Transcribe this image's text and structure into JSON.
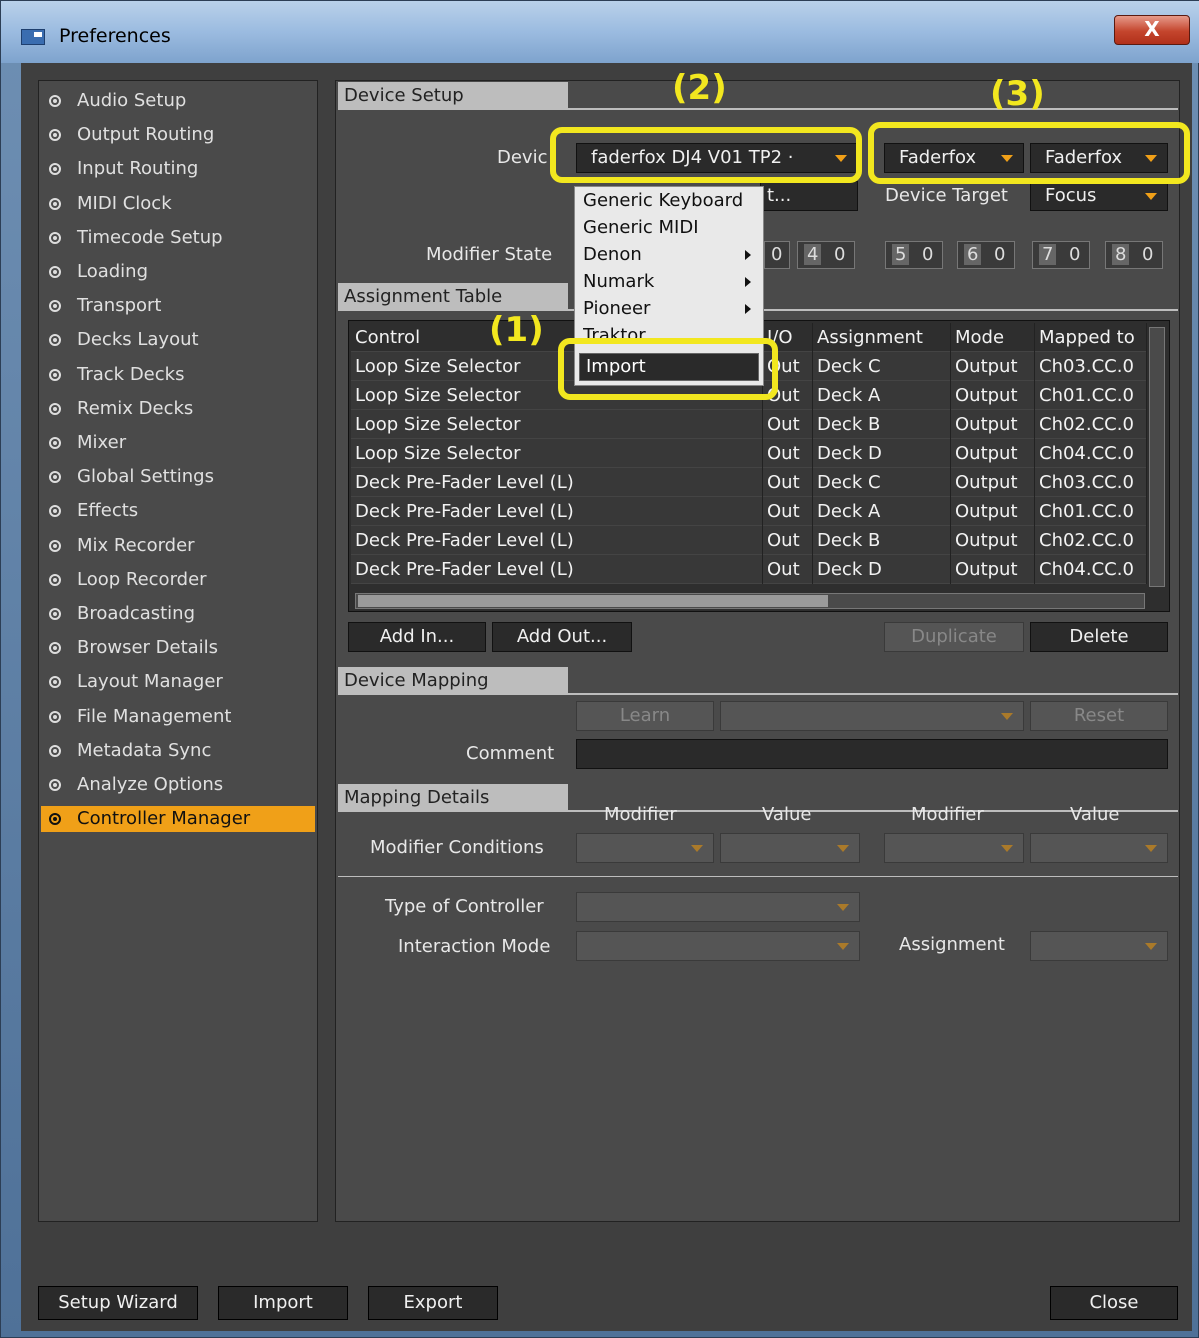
{
  "window": {
    "title": "Preferences",
    "close_label": "X"
  },
  "nav": {
    "items": [
      {
        "label": "Audio Setup"
      },
      {
        "label": "Output Routing"
      },
      {
        "label": "Input Routing"
      },
      {
        "label": "MIDI Clock"
      },
      {
        "label": "Timecode Setup"
      },
      {
        "label": "Loading"
      },
      {
        "label": "Transport"
      },
      {
        "label": "Decks Layout"
      },
      {
        "label": "Track Decks"
      },
      {
        "label": "Remix Decks"
      },
      {
        "label": "Mixer"
      },
      {
        "label": "Global Settings"
      },
      {
        "label": "Effects"
      },
      {
        "label": "Mix Recorder"
      },
      {
        "label": "Loop Recorder"
      },
      {
        "label": "Broadcasting"
      },
      {
        "label": "Browser Details"
      },
      {
        "label": "Layout Manager"
      },
      {
        "label": "File Management"
      },
      {
        "label": "Metadata Sync"
      },
      {
        "label": "Analyze Options"
      },
      {
        "label": "Controller Manager"
      }
    ],
    "active": "Controller Manager"
  },
  "device_setup": {
    "header": "Device Setup",
    "device_label": "Devic",
    "device_value": "faderfox DJ4  V01 TP2 ·",
    "in_port": "Faderfox",
    "out_port": "Faderfox",
    "add_partial": "t...",
    "device_target_label": "Device Target",
    "device_target_value": "Focus",
    "modifier_state_label": "Modifier State",
    "modifiers": [
      {
        "k": "4",
        "v": "0"
      },
      {
        "k": "5",
        "v": "0"
      },
      {
        "k": "6",
        "v": "0"
      },
      {
        "k": "7",
        "v": "0"
      },
      {
        "k": "8",
        "v": "0"
      }
    ],
    "modifier3_value": "0"
  },
  "dropdown_menu": {
    "items": [
      {
        "label": "Generic Keyboard"
      },
      {
        "label": "Generic MIDI"
      },
      {
        "label": "Denon"
      },
      {
        "label": "Numark"
      },
      {
        "label": "Pioneer"
      },
      {
        "label": "Traktor"
      }
    ],
    "selected": "Import"
  },
  "assignment_table": {
    "header": "Assignment Table",
    "columns": [
      "Control",
      "I/O",
      "Assignment",
      "Mode",
      "Mapped to"
    ],
    "rows": [
      {
        "control": "Loop Size Selector",
        "io": "Out",
        "assignment": "Deck C",
        "mode": "Output",
        "mapped": "Ch03.CC.0"
      },
      {
        "control": "Loop Size Selector",
        "io": "Out",
        "assignment": "Deck A",
        "mode": "Output",
        "mapped": "Ch01.CC.0"
      },
      {
        "control": "Loop Size Selector",
        "io": "Out",
        "assignment": "Deck B",
        "mode": "Output",
        "mapped": "Ch02.CC.0"
      },
      {
        "control": "Loop Size Selector",
        "io": "Out",
        "assignment": "Deck D",
        "mode": "Output",
        "mapped": "Ch04.CC.0"
      },
      {
        "control": "Deck Pre-Fader Level (L)",
        "io": "Out",
        "assignment": "Deck C",
        "mode": "Output",
        "mapped": "Ch03.CC.0"
      },
      {
        "control": "Deck Pre-Fader Level (L)",
        "io": "Out",
        "assignment": "Deck A",
        "mode": "Output",
        "mapped": "Ch01.CC.0"
      },
      {
        "control": "Deck Pre-Fader Level (L)",
        "io": "Out",
        "assignment": "Deck B",
        "mode": "Output",
        "mapped": "Ch02.CC.0"
      },
      {
        "control": "Deck Pre-Fader Level (L)",
        "io": "Out",
        "assignment": "Deck D",
        "mode": "Output",
        "mapped": "Ch04.CC.0"
      }
    ],
    "add_in": "Add In...",
    "add_out": "Add Out...",
    "duplicate": "Duplicate",
    "delete": "Delete"
  },
  "device_mapping": {
    "header": "Device Mapping",
    "learn": "Learn",
    "reset": "Reset",
    "comment_label": "Comment",
    "comment_value": ""
  },
  "mapping_details": {
    "header": "Mapping Details",
    "modifier1": "Modifier",
    "value1": "Value",
    "modifier2": "Modifier",
    "value2": "Value",
    "modifier_conditions": "Modifier Conditions",
    "type_of_controller": "Type of Controller",
    "interaction_mode": "Interaction Mode",
    "assignment_label": "Assignment"
  },
  "annotations": {
    "a1": "(1)",
    "a2": "(2)",
    "a3": "(3)"
  },
  "footer": {
    "setup_wizard": "Setup Wizard",
    "import": "Import",
    "export": "Export",
    "close": "Close"
  },
  "colors": {
    "accent": "#f0a018",
    "highlight": "#f2e71f",
    "panel": "#4a4a4a"
  }
}
